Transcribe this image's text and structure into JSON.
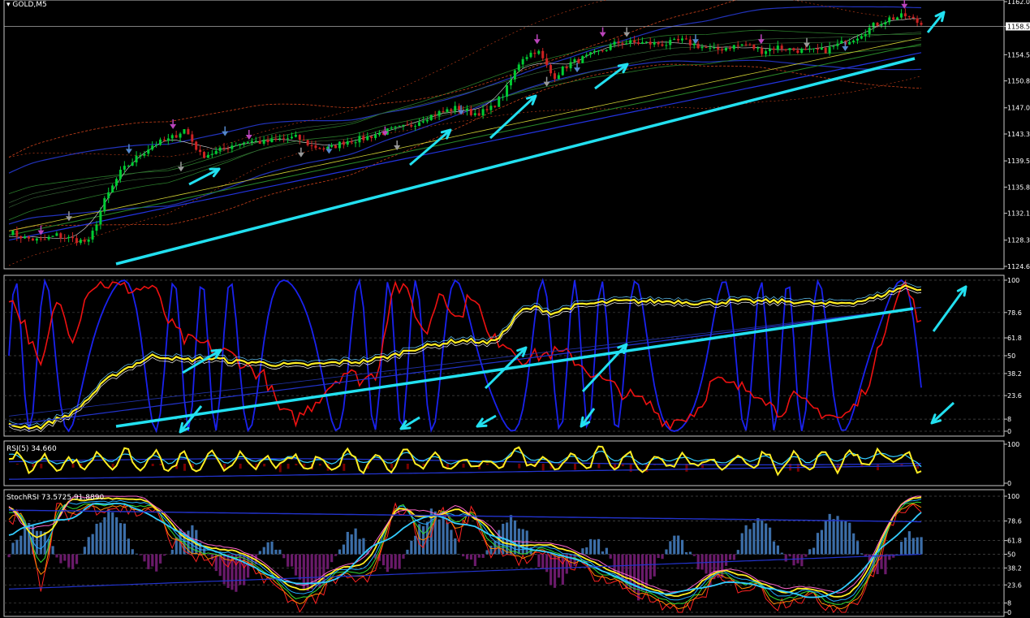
{
  "window": {
    "symbol_label": "GOLD,M5",
    "current_price_label": "1158.5"
  },
  "colors": {
    "background": "#000000",
    "frame": "#c8c8c8",
    "grid": "#303030",
    "bull": "#00cc33",
    "bear": "#cc2222",
    "arrow": "#22e0f0",
    "yellow": "#ffee22",
    "blue": "#1122dd",
    "red": "#ee1111",
    "cyan_line": "#33ccff",
    "hist_pos": "#3c6ea8",
    "hist_neg": "#6a1a6a",
    "dark_red": "#7a0000"
  },
  "price_axis": {
    "ticks": [
      "1162.0",
      "1158.5",
      "1154.5",
      "1150.8",
      "1147.0",
      "1143.3",
      "1139.5",
      "1135.8",
      "1132.1",
      "1128.3",
      "1124.6"
    ]
  },
  "panel2_axis": {
    "ticks": [
      "100",
      "78.6",
      "61.8",
      "50",
      "38.2",
      "23.6",
      "8",
      "0"
    ]
  },
  "panel3": {
    "title": "RSI(5) 34.660",
    "ticks": [
      "100",
      "0"
    ]
  },
  "panel4": {
    "title": "StochRSI 73.5725 91.8890",
    "ticks": [
      "100",
      "78.6",
      "61.8",
      "50",
      "38.2",
      "23.6",
      "8",
      "0"
    ]
  },
  "chart_data": [
    {
      "type": "candlestick",
      "title": "GOLD,M5",
      "ylim": [
        1124.6,
        1162.0
      ],
      "x": [
        0,
        20,
        40,
        60,
        80,
        100,
        120,
        140,
        160,
        180,
        200,
        220,
        240,
        260,
        280,
        300,
        320,
        340,
        360,
        380,
        400,
        420,
        440,
        460,
        480,
        500,
        520,
        540,
        560,
        580,
        600,
        620,
        640,
        660,
        680,
        700,
        720,
        740,
        760,
        780,
        800,
        820,
        840,
        860,
        880,
        900,
        920,
        940,
        960,
        980,
        1000,
        1020,
        1040,
        1060,
        1080,
        1100,
        1120,
        1140
      ],
      "close": [
        1129.5,
        1128.6,
        1128.2,
        1129.0,
        1128.4,
        1128.0,
        1134.0,
        1138.0,
        1140.0,
        1141.8,
        1142.5,
        1144.0,
        1140.2,
        1140.8,
        1141.8,
        1142.3,
        1142.1,
        1142.6,
        1142.8,
        1141.5,
        1141.2,
        1142.3,
        1142.6,
        1143.3,
        1143.9,
        1144.4,
        1145.6,
        1146.4,
        1147.0,
        1146.2,
        1146.6,
        1149.2,
        1154.0,
        1155.2,
        1151.3,
        1153.2,
        1154.1,
        1155.0,
        1156.2,
        1156.2,
        1156.1,
        1156.0,
        1156.5,
        1155.8,
        1155.1,
        1155.6,
        1156.0,
        1155.0,
        1155.6,
        1155.2,
        1155.0,
        1155.1,
        1156.1,
        1157.1,
        1158.6,
        1159.6,
        1160.0,
        1158.8
      ],
      "annotations": "cyan trend arrows"
    },
    {
      "type": "line",
      "series": [
        {
          "values": [
            4,
            3,
            3,
            8,
            12,
            22,
            33,
            40,
            45,
            50,
            49,
            47,
            48,
            48,
            46,
            46,
            45,
            44,
            44,
            44,
            45,
            46,
            46,
            48,
            50,
            54,
            56,
            58,
            60,
            60,
            58,
            66,
            80,
            82,
            78,
            82,
            84,
            85,
            86,
            86,
            86,
            86,
            86,
            85,
            85,
            86,
            86,
            86,
            86,
            86,
            85,
            84,
            85,
            86,
            88,
            92,
            96,
            94
          ]
        }
      ],
      "ylim": [
        0,
        100
      ]
    },
    {
      "type": "line",
      "series": [
        {
          "values": [
            55,
            58,
            45,
            60,
            40,
            65,
            52,
            70,
            48,
            62,
            45,
            58,
            40,
            66,
            50,
            60,
            42,
            64,
            46,
            58,
            44,
            70,
            50,
            62,
            48,
            76,
            54,
            64,
            42,
            58,
            40,
            68,
            72,
            56,
            44,
            66,
            52,
            70,
            48,
            60,
            46,
            66,
            52,
            58,
            44,
            62,
            50,
            68,
            46,
            60,
            48,
            64,
            50,
            66,
            56,
            70,
            60,
            50
          ]
        }
      ],
      "ylim": [
        0,
        100
      ]
    },
    {
      "type": "line",
      "series": [
        {
          "values": [
            88,
            92,
            20,
            96,
            90,
            96,
            98,
            96,
            92,
            96,
            70,
            60,
            52,
            50,
            48,
            42,
            38,
            22,
            12,
            18,
            28,
            36,
            32,
            40,
            98,
            92,
            60,
            98,
            70,
            96,
            58,
            62,
            50,
            52,
            55,
            50,
            44,
            36,
            30,
            24,
            18,
            6,
            8,
            14,
            34,
            30,
            28,
            28,
            12,
            20,
            18,
            14,
            10,
            16,
            38,
            78,
            98,
            88
          ]
        }
      ],
      "ylim": [
        0,
        100
      ]
    }
  ]
}
